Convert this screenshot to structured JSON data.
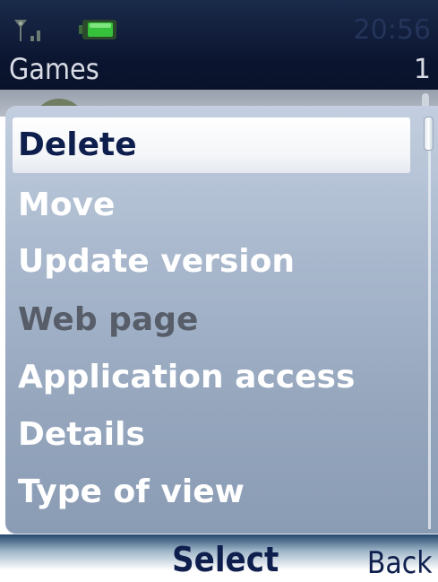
{
  "status_bar": {
    "time": "20:56",
    "signal_icon": "signal-strength-icon",
    "battery_icon": "battery-icon"
  },
  "header": {
    "title": "Games",
    "count": "1"
  },
  "options_menu": {
    "items": [
      {
        "label": "Delete",
        "state": "selected"
      },
      {
        "label": "Move",
        "state": "normal"
      },
      {
        "label": "Update version",
        "state": "normal"
      },
      {
        "label": "Web page",
        "state": "disabled"
      },
      {
        "label": "Application access",
        "state": "normal"
      },
      {
        "label": "Details",
        "state": "normal"
      },
      {
        "label": "Type of view",
        "state": "normal"
      }
    ]
  },
  "softkeys": {
    "middle": "Select",
    "right": "Back"
  },
  "colors": {
    "selected_text": "#0e1f4d",
    "normal_text": "#ffffff",
    "disabled_text": "#575e69",
    "header_bg": "#0b1530",
    "popup_bg": "#a9b8cd"
  }
}
